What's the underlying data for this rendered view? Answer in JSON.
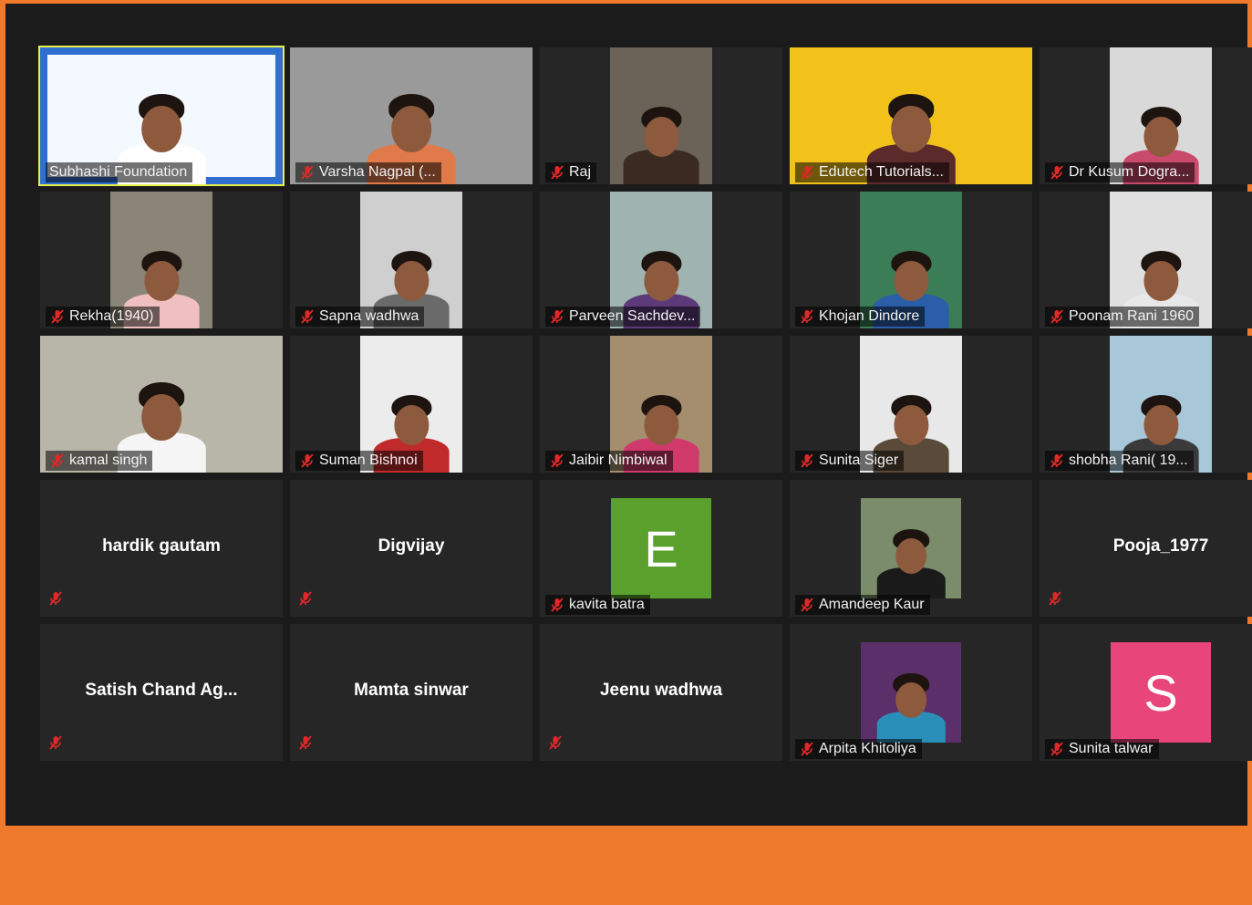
{
  "meeting": {
    "participants": [
      {
        "name": "Subhashi Foundation",
        "kind": "video",
        "active": true,
        "muted": false,
        "bg": "#2f6fd0"
      },
      {
        "name": "Varsha Nagpal  (...",
        "kind": "video",
        "muted": true,
        "bg": "#9a9a9a"
      },
      {
        "name": "Raj",
        "kind": "video",
        "muted": true,
        "bg": "#6b6258"
      },
      {
        "name": "Edutech Tutorials...",
        "kind": "video",
        "muted": true,
        "bg": "#f2c21a"
      },
      {
        "name": "Dr Kusum Dogra...",
        "kind": "video",
        "muted": true,
        "bg": "#d9d9d9"
      },
      {
        "name": "Rekha(1940)",
        "kind": "video",
        "muted": true,
        "bg": "#8a8577"
      },
      {
        "name": "Sapna wadhwa",
        "kind": "video",
        "muted": true,
        "bg": "#cfcfcf"
      },
      {
        "name": "Parveen Sachdev...",
        "kind": "video",
        "muted": true,
        "bg": "#9fb3b0"
      },
      {
        "name": "Khojan Dindore",
        "kind": "video",
        "muted": true,
        "bg": "#3a7d56"
      },
      {
        "name": "Poonam Rani 1960",
        "kind": "video",
        "muted": true,
        "bg": "#e0e0e0"
      },
      {
        "name": "kamal singh",
        "kind": "video",
        "muted": true,
        "bg": "#b8b6a8"
      },
      {
        "name": "Suman Bishnoi",
        "kind": "video",
        "muted": true,
        "bg": "#ececec"
      },
      {
        "name": "Jaibir Nimbiwal",
        "kind": "video",
        "muted": true,
        "bg": "#a58e6e"
      },
      {
        "name": "Sunita Siger",
        "kind": "video",
        "muted": true,
        "bg": "#e8e8e8"
      },
      {
        "name": "shobha Rani( 19...",
        "kind": "video",
        "muted": true,
        "bg": "#a8c7d8"
      },
      {
        "name": "hardik gautam",
        "kind": "name-only",
        "muted": true
      },
      {
        "name": "Digvijay",
        "kind": "name-only",
        "muted": true
      },
      {
        "name": "kavita batra",
        "kind": "letter",
        "letter": "E",
        "color": "#5aa02c",
        "muted": true
      },
      {
        "name": "Amandeep Kaur",
        "kind": "photo",
        "muted": true,
        "bg": "#7a8c6a"
      },
      {
        "name": "Pooja_1977",
        "kind": "name-only",
        "muted": true
      },
      {
        "name": "Satish Chand Ag...",
        "kind": "name-only",
        "muted": true
      },
      {
        "name": "Mamta sinwar",
        "kind": "name-only",
        "muted": true
      },
      {
        "name": "Jeenu wadhwa",
        "kind": "name-only",
        "muted": true
      },
      {
        "name": "Arpita Khitoliya",
        "kind": "photo",
        "muted": true,
        "bg": "#5a2f6a"
      },
      {
        "name": "Sunita talwar",
        "kind": "letter",
        "letter": "S",
        "color": "#e8457a",
        "muted": true
      }
    ]
  },
  "colors": {
    "active_border": "#e6f04a",
    "muted_icon": "#e02828",
    "tile_bg": "#262626"
  },
  "icons": {
    "muted": "microphone-muted-icon"
  }
}
